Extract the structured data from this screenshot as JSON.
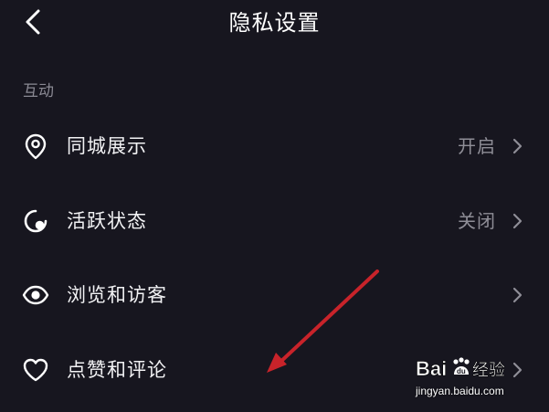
{
  "header": {
    "title": "隐私设置"
  },
  "section": {
    "label": "互动"
  },
  "rows": [
    {
      "label": "同城展示",
      "value": "开启",
      "icon": "location-pin-icon"
    },
    {
      "label": "活跃状态",
      "value": "关闭",
      "icon": "active-status-icon"
    },
    {
      "label": "浏览和访客",
      "value": "",
      "icon": "eye-icon"
    },
    {
      "label": "点赞和评论",
      "value": "",
      "icon": "heart-icon"
    }
  ],
  "watermark": {
    "logo_text": "Bai du 经验",
    "url": "jingyan.baidu.com"
  },
  "colors": {
    "background": "#17161f",
    "text_primary": "#f2f2f4",
    "text_secondary": "#8f8e97",
    "annotation_arrow": "#c8232a"
  }
}
